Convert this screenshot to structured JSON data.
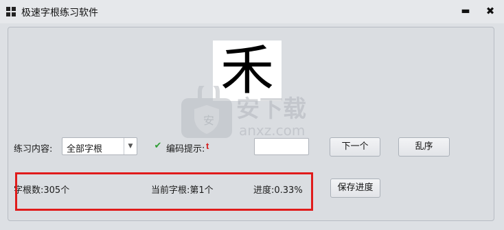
{
  "window": {
    "title": "极速字根练习软件",
    "minimize_glyph": "▬",
    "close_glyph": "✖"
  },
  "display": {
    "current_char": "禾"
  },
  "practice": {
    "label": "练习内容:",
    "selected": "全部字根",
    "options": [
      "全部字根"
    ]
  },
  "hint": {
    "checked": true,
    "label": "编码提示:",
    "value": "t",
    "value_color": "#d42020"
  },
  "answer": {
    "value": ""
  },
  "buttons": {
    "next": "下一个",
    "shuffle": "乱序",
    "save": "保存进度"
  },
  "stats": {
    "count": "字根数:305个",
    "current": "当前字根:第1个",
    "progress": "进度:0.33%"
  },
  "watermark": {
    "text": "安下载",
    "domain": "anxz.com"
  },
  "colors": {
    "highlight": "#e01b1b",
    "checkbox": "#2e9d33"
  }
}
